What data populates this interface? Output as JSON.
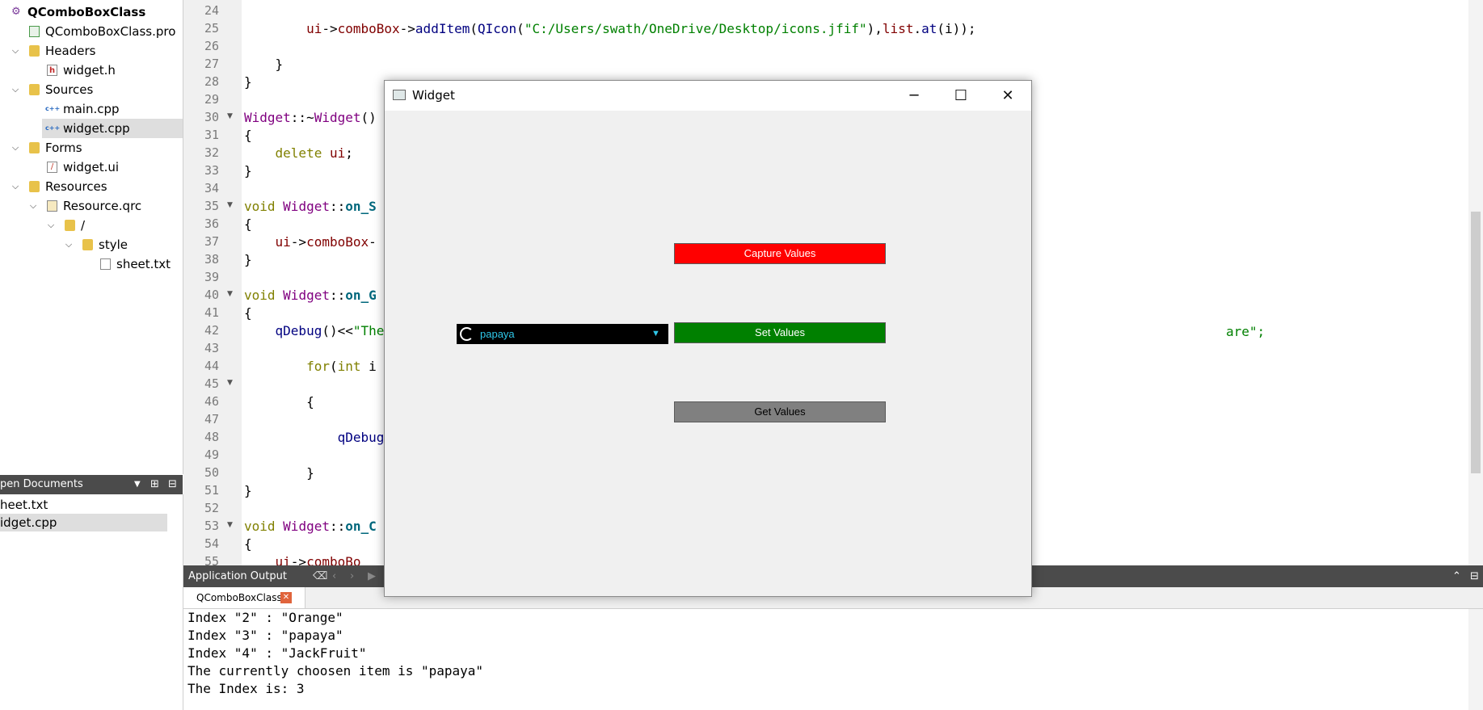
{
  "project_tree": {
    "items": [
      {
        "label": "QComboBoxClass",
        "icon": "project-icon",
        "expanded": true,
        "bold": true
      },
      {
        "label": "QComboBoxClass.pro",
        "icon": "pro-file-icon"
      },
      {
        "label": "Headers",
        "icon": "folder-icon",
        "expanded": true
      },
      {
        "label": "widget.h",
        "icon": "header-file-icon"
      },
      {
        "label": "Sources",
        "icon": "folder-icon",
        "expanded": true
      },
      {
        "label": "main.cpp",
        "icon": "cpp-file-icon"
      },
      {
        "label": "widget.cpp",
        "icon": "cpp-file-icon",
        "selected": true
      },
      {
        "label": "Forms",
        "icon": "folder-icon",
        "expanded": true
      },
      {
        "label": "widget.ui",
        "icon": "ui-file-icon"
      },
      {
        "label": "Resources",
        "icon": "folder-icon",
        "expanded": true
      },
      {
        "label": "Resource.qrc",
        "icon": "qrc-file-icon",
        "expanded": true
      },
      {
        "label": "/",
        "icon": "folder-icon",
        "expanded": true
      },
      {
        "label": "style",
        "icon": "folder-icon",
        "expanded": true
      },
      {
        "label": "sheet.txt",
        "icon": "text-file-icon"
      }
    ]
  },
  "open_documents": {
    "title": "pen Documents",
    "items": [
      {
        "label": "heet.txt"
      },
      {
        "label": "idget.cpp",
        "selected": true
      }
    ]
  },
  "editor": {
    "lines": [
      {
        "n": "24",
        "code": ""
      },
      {
        "n": "25",
        "code": "        ui->comboBox->addItem(QIcon(\"C:/Users/swath/OneDrive/Desktop/icons.jfif\"),list.at(i));"
      },
      {
        "n": "26",
        "code": ""
      },
      {
        "n": "27",
        "code": "    }"
      },
      {
        "n": "28",
        "code": "}"
      },
      {
        "n": "29",
        "code": ""
      },
      {
        "n": "30",
        "code": "Widget::~Widget()"
      },
      {
        "n": "31",
        "code": "{"
      },
      {
        "n": "32",
        "code": "    delete ui;"
      },
      {
        "n": "33",
        "code": "}"
      },
      {
        "n": "34",
        "code": ""
      },
      {
        "n": "35",
        "code": "void Widget::on_S"
      },
      {
        "n": "36",
        "code": "{"
      },
      {
        "n": "37",
        "code": "    ui->comboBox-"
      },
      {
        "n": "38",
        "code": "}"
      },
      {
        "n": "39",
        "code": ""
      },
      {
        "n": "40",
        "code": "void Widget::on_G"
      },
      {
        "n": "41",
        "code": "{"
      },
      {
        "n": "42",
        "code": "    qDebug()<<\"The"
      },
      {
        "n": "43",
        "code": ""
      },
      {
        "n": "44",
        "code": "        for(int i"
      },
      {
        "n": "45",
        "code": ""
      },
      {
        "n": "46",
        "code": "        {"
      },
      {
        "n": "47",
        "code": ""
      },
      {
        "n": "48",
        "code": "            qDebug"
      },
      {
        "n": "49",
        "code": ""
      },
      {
        "n": "50",
        "code": "        }"
      },
      {
        "n": "51",
        "code": "}"
      },
      {
        "n": "52",
        "code": ""
      },
      {
        "n": "53",
        "code": "void Widget::on_C"
      },
      {
        "n": "54",
        "code": "{"
      },
      {
        "n": "55",
        "code": "    ui->comboBo"
      }
    ],
    "line42_tail": "are\";"
  },
  "output_panel": {
    "title": "Application Output",
    "tab_label": "QComboBoxClass",
    "lines": [
      "Index \"2\" : \"Orange\"",
      "Index \"3\" : \"papaya\"",
      "Index \"4\" : \"JackFruit\"",
      "The currently choosen item is \"papaya\"",
      "The Index is: 3"
    ]
  },
  "widget_window": {
    "title": "Widget",
    "combo_value": "papaya",
    "buttons": {
      "capture": "Capture Values",
      "set": "Set Values",
      "get": "Get Values"
    },
    "colors": {
      "capture_bg": "#ff0000",
      "set_bg": "#008000",
      "get_bg": "#808080",
      "combo_bg": "#000000",
      "combo_text": "#2fc7e8"
    }
  }
}
